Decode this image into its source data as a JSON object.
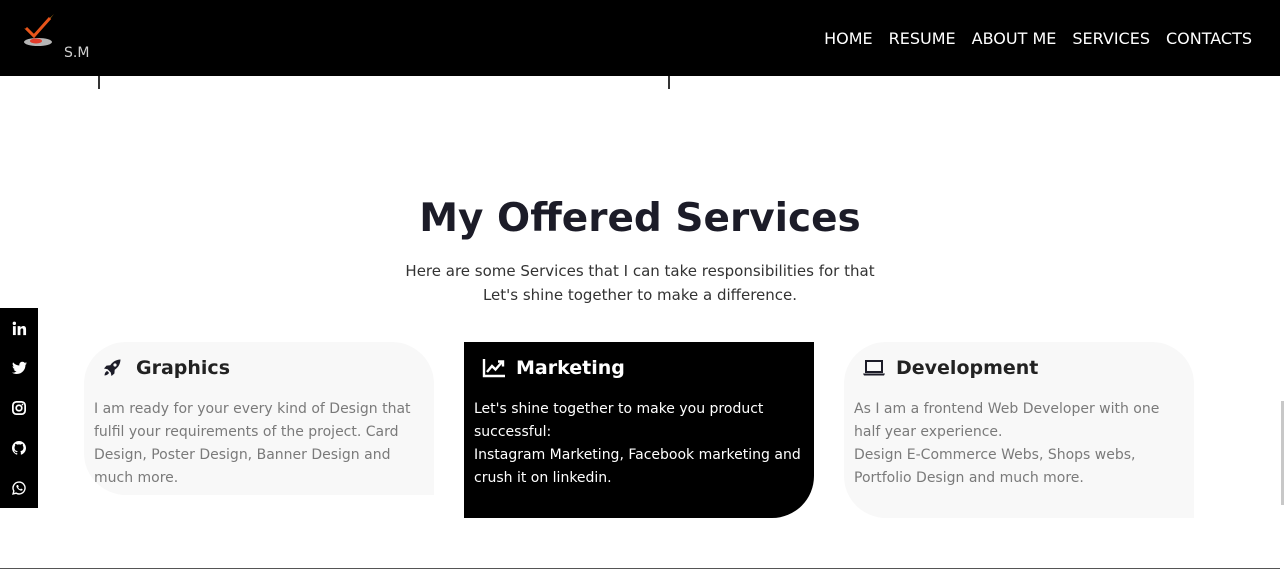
{
  "brand": {
    "logo_text": "S.M"
  },
  "nav": {
    "items": [
      "HOME",
      "RESUME",
      "ABOUT ME",
      "SERVICES",
      "CONTACTS"
    ]
  },
  "services": {
    "title": "My Offered Services",
    "subtitle_line1": "Here are some Services that I can take responsibilities for that",
    "subtitle_line2": "Let's shine together to make a difference.",
    "cards": [
      {
        "icon": "rocket-icon",
        "title": "Graphics",
        "lines": [
          "I am ready for your every kind of Design that fulfil your requirements of the project. Card Design, Poster Design, Banner Design and much more."
        ]
      },
      {
        "icon": "chart-line-icon",
        "title": "Marketing",
        "lines": [
          "Let's shine together to make you product successful:",
          "Instagram Marketing, Facebook marketing and crush it on linkedin."
        ]
      },
      {
        "icon": "laptop-icon",
        "title": "Development",
        "lines": [
          "As I am a frontend Web Developer with one half year experience.",
          "Design E-Commerce Webs, Shops webs, Portfolio Design and much more."
        ]
      }
    ]
  },
  "social": [
    "linkedin-icon",
    "twitter-icon",
    "instagram-icon",
    "github-icon",
    "whatsapp-icon"
  ],
  "colors": {
    "nav_bg": "#000000",
    "card_light": "#f8f8f8",
    "card_dark": "#000000",
    "accent_logo": "#e8541a"
  }
}
